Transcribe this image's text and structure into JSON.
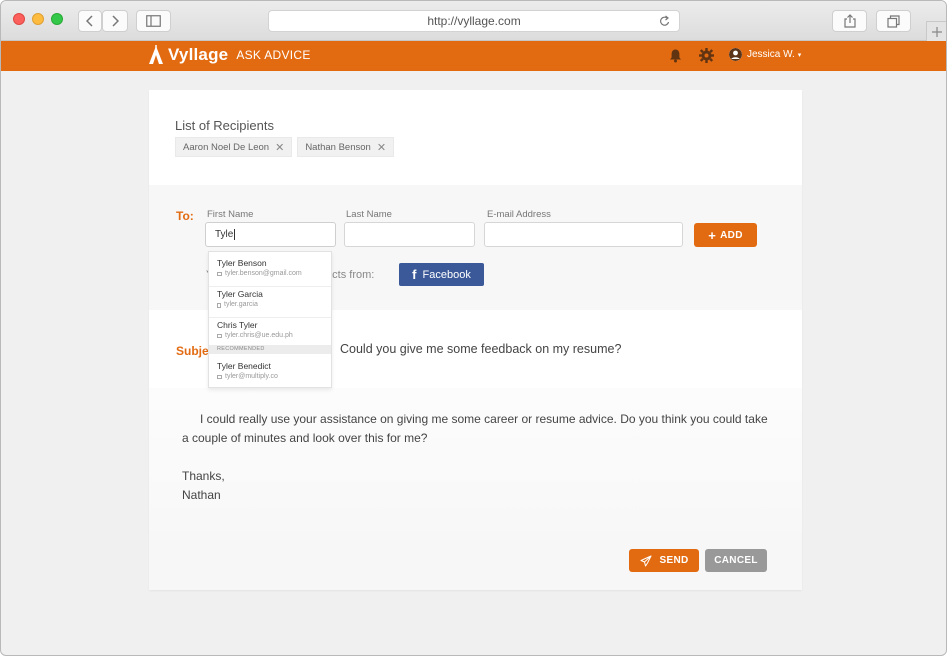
{
  "browser": {
    "url": "http://vyllage.com"
  },
  "app": {
    "name": "Vyllage",
    "section": "ASK ADVICE",
    "user": "Jessica W.",
    "caret": "▾",
    "brand_color": "#e26b12"
  },
  "recipients": {
    "title": "List of Recipients",
    "chips": [
      {
        "name": "Aaron Noel De Leon",
        "remove": "✕"
      },
      {
        "name": "Nathan Benson",
        "remove": "✕"
      }
    ]
  },
  "to": {
    "label": "To:",
    "first_name_label": "First Name",
    "first_name_value": "Tyle",
    "last_name_label": "Last Name",
    "email_label": "E-mail Address",
    "add_label": "ADD",
    "add_icon": "+",
    "import_text": "You can also import contacts from:",
    "facebook_label": "Facebook",
    "facebook_icon": "f",
    "facebook_color": "#3b5998"
  },
  "autocomplete": {
    "items": [
      {
        "name": "Tyler Benson",
        "detail": "tyler.benson@gmail.com"
      },
      {
        "name": "Tyler Garcia",
        "detail": "tyler.garcia"
      },
      {
        "name": "Chris Tyler",
        "detail": "tyler.chris@ue.edu.ph"
      }
    ],
    "recommended_label": "RECOMMENDED",
    "recommended": [
      {
        "name": "Tyler Benedict",
        "detail": "tyler@multiply.co"
      }
    ]
  },
  "subject": {
    "label": "Subject:",
    "value": "Could you give me some feedback on my resume?"
  },
  "message": {
    "paragraph": "I could really use your assistance on giving me some career or resume advice. Do you think you could take a couple of minutes and look over this for me?",
    "closing": "Thanks,",
    "signature": "Nathan"
  },
  "actions": {
    "send_label": "SEND",
    "cancel_label": "CANCEL"
  }
}
